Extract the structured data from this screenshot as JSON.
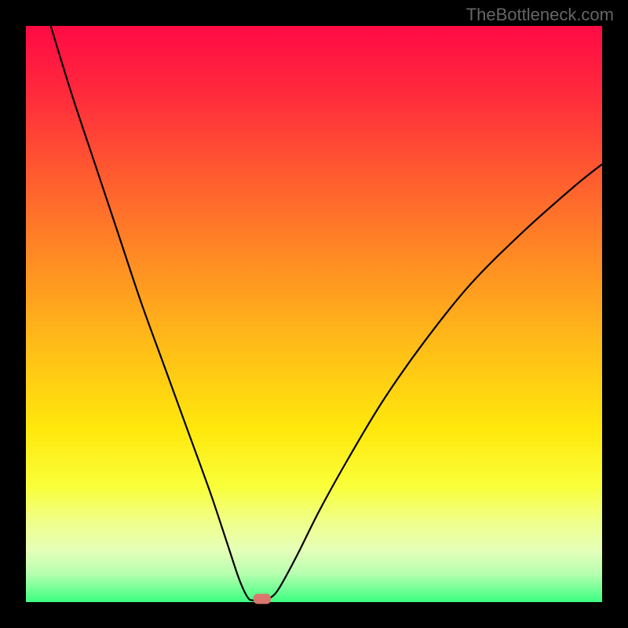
{
  "watermark": "TheBottleneck.com",
  "chart_data": {
    "type": "line",
    "title": "",
    "xlabel": "",
    "ylabel": "",
    "xlim": [
      0,
      100
    ],
    "ylim": [
      0,
      100
    ],
    "minimum_x": 40,
    "background_gradient": {
      "stops": [
        {
          "offset": 0,
          "color": "#ff0a44"
        },
        {
          "offset": 12,
          "color": "#ff2b3c"
        },
        {
          "offset": 25,
          "color": "#ff5830"
        },
        {
          "offset": 40,
          "color": "#ff8a24"
        },
        {
          "offset": 55,
          "color": "#ffbb18"
        },
        {
          "offset": 70,
          "color": "#ffe80c"
        },
        {
          "offset": 80,
          "color": "#f9ff3a"
        },
        {
          "offset": 86,
          "color": "#f0ff8a"
        },
        {
          "offset": 91,
          "color": "#e5ffb8"
        },
        {
          "offset": 95,
          "color": "#b8ffb0"
        },
        {
          "offset": 100,
          "color": "#3cff80"
        }
      ]
    },
    "curve_points": [
      {
        "x": 4.3,
        "y": 100
      },
      {
        "x": 8,
        "y": 88
      },
      {
        "x": 12,
        "y": 76
      },
      {
        "x": 16,
        "y": 64
      },
      {
        "x": 20,
        "y": 52
      },
      {
        "x": 24,
        "y": 41
      },
      {
        "x": 28,
        "y": 30
      },
      {
        "x": 32,
        "y": 19
      },
      {
        "x": 35,
        "y": 10
      },
      {
        "x": 37,
        "y": 4
      },
      {
        "x": 38.5,
        "y": 0.8
      },
      {
        "x": 39.5,
        "y": 0.3
      },
      {
        "x": 41,
        "y": 0.3
      },
      {
        "x": 42.5,
        "y": 0.8
      },
      {
        "x": 44,
        "y": 2.5
      },
      {
        "x": 47,
        "y": 8
      },
      {
        "x": 51,
        "y": 16
      },
      {
        "x": 56,
        "y": 25
      },
      {
        "x": 62,
        "y": 35
      },
      {
        "x": 69,
        "y": 45
      },
      {
        "x": 77,
        "y": 55
      },
      {
        "x": 86,
        "y": 64
      },
      {
        "x": 95,
        "y": 72
      },
      {
        "x": 100,
        "y": 76
      }
    ],
    "marker": {
      "x": 41,
      "y": 0.5,
      "color": "#d9776f"
    },
    "border_color": "#000000"
  }
}
